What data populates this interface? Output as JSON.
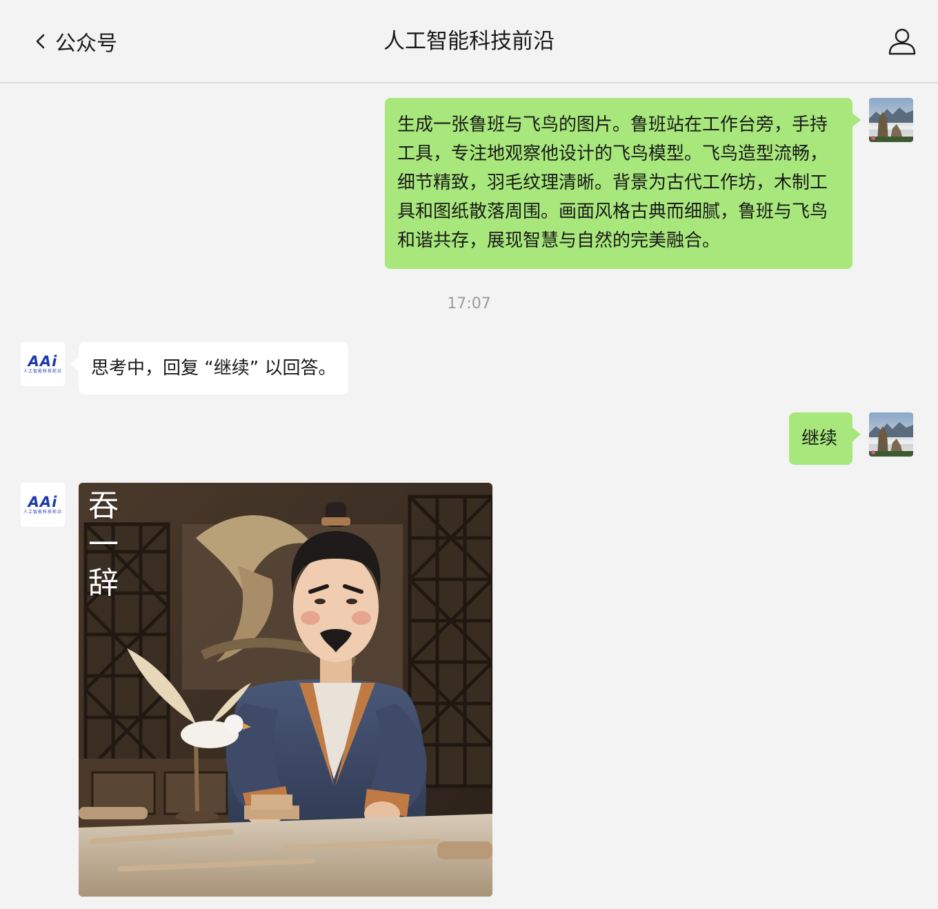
{
  "header": {
    "back_label": "公众号",
    "title": "人工智能科技前沿"
  },
  "messages": {
    "prompt": "生成一张鲁班与飞鸟的图片。鲁班站在工作台旁，手持工具，专注地观察他设计的飞鸟模型。飞鸟造型流畅，细节精致，羽毛纹理清晰。背景为古代工作坊，木制工具和图纸散落周围。画面风格古典而细腻，鲁班与飞鸟和谐共存，展现智慧与自然的完美融合。",
    "timestamp": "17:07",
    "bot_thinking": "思考中，回复 “继续” 以回答。",
    "continue": "继续"
  },
  "bot_avatar": {
    "logo": "AAi",
    "subtitle": "人工智能科技前沿"
  },
  "image": {
    "calligraphy": "吞一辞"
  },
  "colors": {
    "sent_bubble": "#a8e77c",
    "received_bubble": "#ffffff",
    "background": "#f3f3f3",
    "logo_blue": "#1e3aa8"
  },
  "icons": {
    "back": "chevron-left-icon",
    "profile": "person-icon"
  }
}
